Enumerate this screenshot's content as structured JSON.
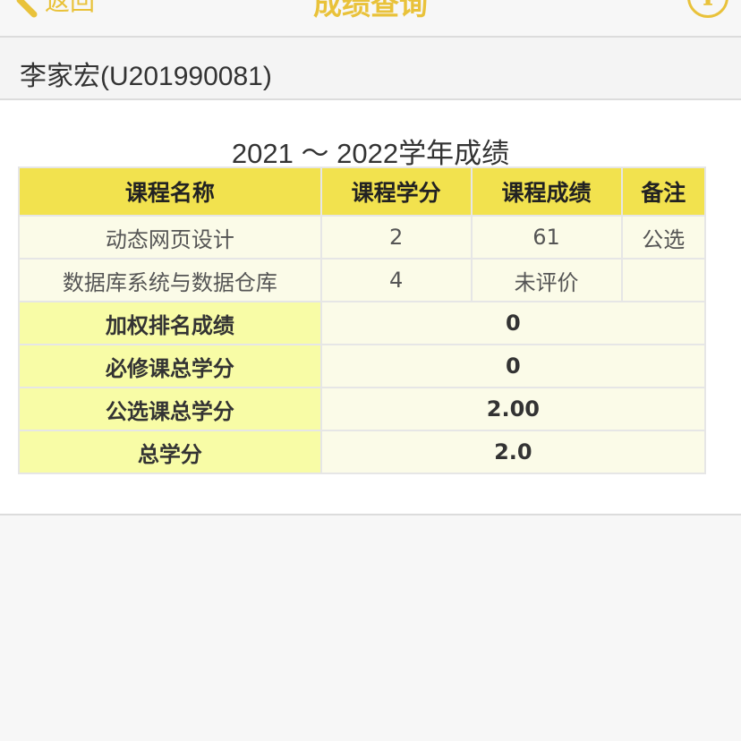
{
  "nav": {
    "back_label": "返回",
    "title": "成绩查询",
    "info_symbol": "i"
  },
  "student": {
    "name_id": "李家宏(U201990081)"
  },
  "year_title": "2021 ～ 2022学年成绩",
  "table": {
    "headers": [
      "课程名称",
      "课程学分",
      "课程成绩",
      "备注"
    ],
    "rows": [
      {
        "course": "动态网页设计",
        "credit": "2",
        "score": "61",
        "note": "公选"
      },
      {
        "course": "数据库系统与数据仓库",
        "credit": "4",
        "score": "未评价",
        "note": ""
      }
    ],
    "summary": [
      {
        "label": "加权排名成绩",
        "value": "0"
      },
      {
        "label": "必修课总学分",
        "value": "0"
      },
      {
        "label": "公选课总学分",
        "value": "2.00"
      },
      {
        "label": "总学分",
        "value": "2.0"
      }
    ]
  },
  "colors": {
    "accent": "#e9c23a",
    "header_bg": "#f2e24e",
    "summary_label_bg": "#f8fca6",
    "cell_bg": "#fbfbe8"
  },
  "icons": {
    "back": "chevron-left-icon",
    "info": "info-circle-icon"
  }
}
